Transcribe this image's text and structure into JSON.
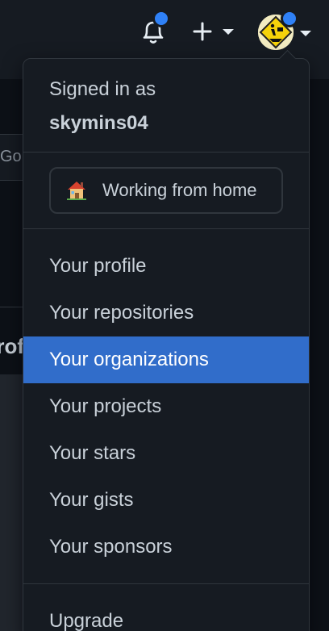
{
  "header": {
    "notifications_icon": "bell-icon",
    "create_icon": "plus-icon",
    "avatar_icon": "beta-man-avatar",
    "accent_color": "#2f81f7"
  },
  "background": {
    "fragment_top": "Go",
    "fragment_mid": "rof"
  },
  "user_menu": {
    "signed_in_label": "Signed in as",
    "username": "skymins04",
    "status": {
      "emoji_icon": "house-icon",
      "text": "Working from home"
    },
    "items": [
      {
        "label": "Your profile",
        "active": false
      },
      {
        "label": "Your repositories",
        "active": false
      },
      {
        "label": "Your organizations",
        "active": true
      },
      {
        "label": "Your projects",
        "active": false
      },
      {
        "label": "Your stars",
        "active": false
      },
      {
        "label": "Your gists",
        "active": false
      },
      {
        "label": "Your sponsors",
        "active": false
      }
    ],
    "upgrade_label": "Upgrade",
    "highlight_color": "#316dca"
  }
}
